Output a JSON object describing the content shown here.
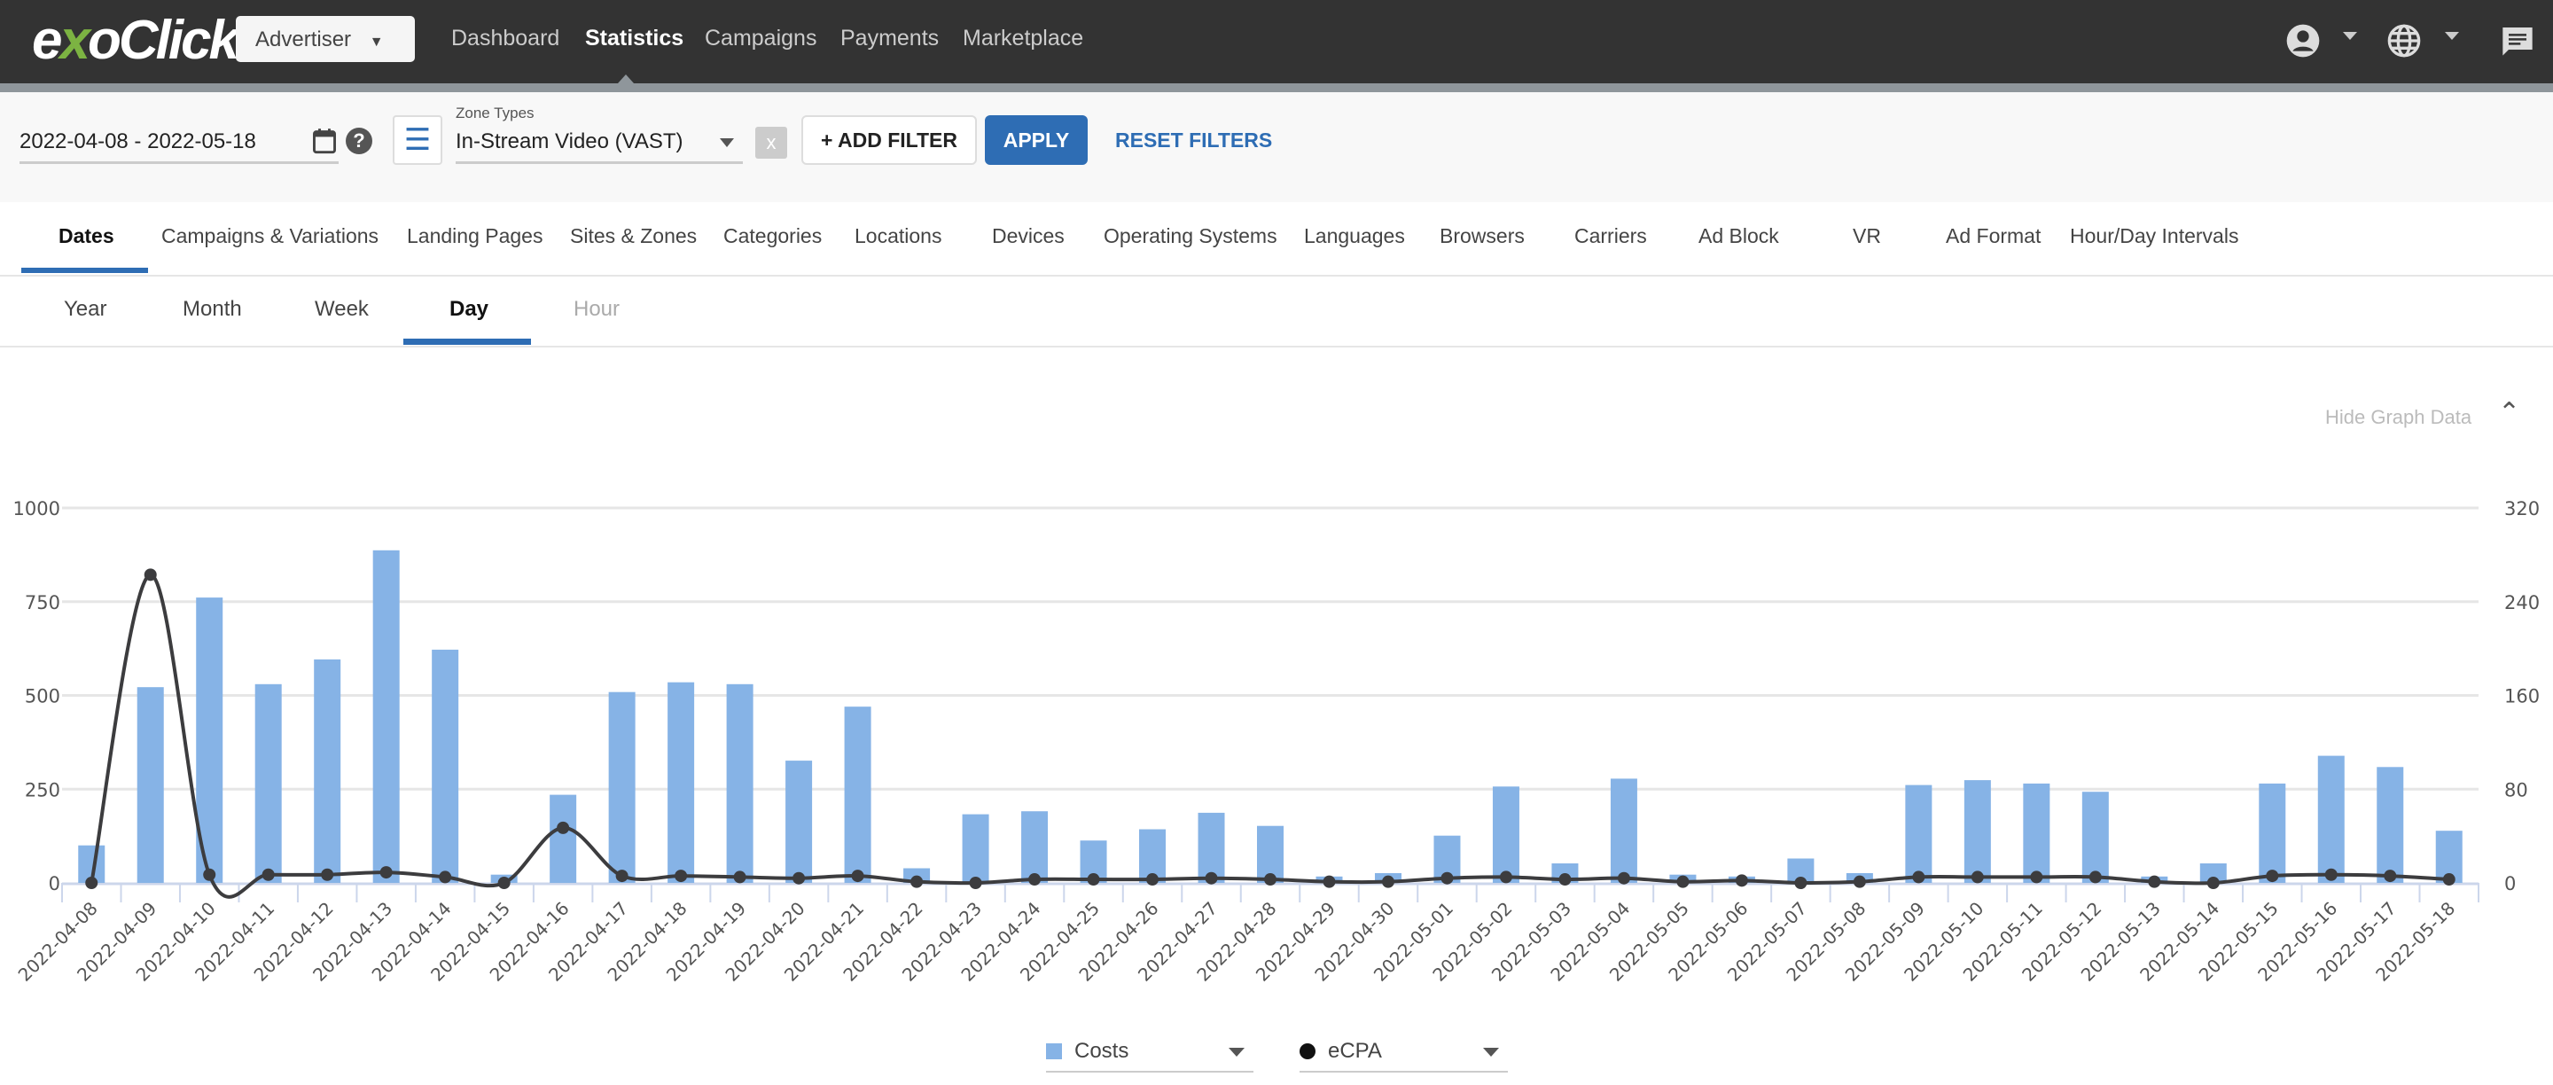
{
  "header": {
    "logo": "exoClick",
    "account_type": "Advertiser",
    "nav": [
      "Dashboard",
      "Statistics",
      "Campaigns",
      "Payments",
      "Marketplace"
    ],
    "active_nav": "Statistics",
    "icons": [
      "user-icon",
      "globe-icon",
      "chat-icon"
    ]
  },
  "filters": {
    "date_range": "2022-04-08 - 2022-05-18",
    "zone_types_label": "Zone Types",
    "zone_types_value": "In-Stream Video (VAST)",
    "clear": "x",
    "add_filter": "+ ADD FILTER",
    "apply": "APPLY",
    "reset": "RESET FILTERS"
  },
  "tabs": [
    "Dates",
    "Campaigns & Variations",
    "Landing Pages",
    "Sites & Zones",
    "Categories",
    "Locations",
    "Devices",
    "Operating Systems",
    "Languages",
    "Browsers",
    "Carriers",
    "Ad Block",
    "VR",
    "Ad Format",
    "Hour/Day Intervals"
  ],
  "active_tab": "Dates",
  "subtabs": [
    "Year",
    "Month",
    "Week",
    "Day",
    "Hour"
  ],
  "active_subtab": "Day",
  "hide_graph": "Hide Graph Data",
  "legend": {
    "left": "Costs",
    "right": "eCPA"
  },
  "colors": {
    "accent": "#2e6db4",
    "bar": "#86b3e6",
    "line": "#3c3c3e",
    "header": "#333333"
  },
  "chart_data": {
    "type": "bar+line",
    "categories": [
      "2022-04-08",
      "2022-04-09",
      "2022-04-10",
      "2022-04-11",
      "2022-04-12",
      "2022-04-13",
      "2022-04-14",
      "2022-04-15",
      "2022-04-16",
      "2022-04-17",
      "2022-04-18",
      "2022-04-19",
      "2022-04-20",
      "2022-04-21",
      "2022-04-22",
      "2022-04-23",
      "2022-04-24",
      "2022-04-25",
      "2022-04-26",
      "2022-04-27",
      "2022-04-28",
      "2022-04-29",
      "2022-04-30",
      "2022-05-01",
      "2022-05-02",
      "2022-05-03",
      "2022-05-04",
      "2022-05-05",
      "2022-05-06",
      "2022-05-07",
      "2022-05-08",
      "2022-05-09",
      "2022-05-10",
      "2022-05-11",
      "2022-05-12",
      "2022-05-13",
      "2022-05-14",
      "2022-05-15",
      "2022-05-16",
      "2022-05-17",
      "2022-05-18"
    ],
    "series": [
      {
        "name": "Costs",
        "axis": "left",
        "type": "bar",
        "values": [
          100,
          522,
          761,
          530,
          596,
          887,
          622,
          22,
          235,
          509,
          535,
          530,
          326,
          470,
          39,
          183,
          191,
          113,
          143,
          187,
          152,
          17,
          26,
          126,
          257,
          52,
          278,
          22,
          17,
          65,
          26,
          261,
          274,
          265,
          243,
          17,
          52,
          265,
          339,
          309,
          139
        ]
      },
      {
        "name": "eCPA",
        "axis": "right",
        "type": "line",
        "values": [
          0,
          263,
          7,
          7,
          7,
          9,
          5,
          0,
          47,
          6,
          6,
          5,
          4,
          6,
          1,
          0,
          3,
          3,
          3,
          4,
          3,
          1,
          1,
          4,
          5,
          3,
          4,
          1,
          2,
          0,
          1,
          5,
          5,
          5,
          5,
          1,
          0,
          6,
          7,
          6,
          3
        ]
      }
    ],
    "left_axis": {
      "ylim": [
        0,
        1000
      ],
      "ticks": [
        0,
        250,
        500,
        750,
        1000
      ]
    },
    "right_axis": {
      "ylim": [
        0,
        320
      ],
      "ticks": [
        0,
        80,
        160,
        240,
        320
      ]
    },
    "grid": true,
    "legend": "bottom"
  }
}
